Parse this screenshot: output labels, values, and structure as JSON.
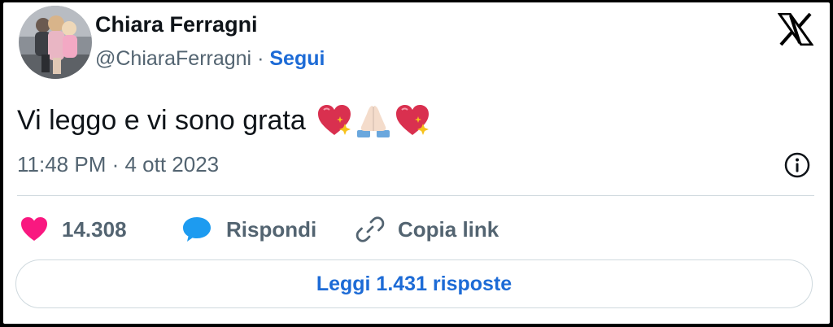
{
  "author": {
    "name": "Chiara Ferragni",
    "handle": "@ChiaraFerragni",
    "separator": "·",
    "follow_label": "Segui"
  },
  "tweet": {
    "text": "Vi leggo e vi sono grata",
    "emojis": [
      "sparkling-heart-icon",
      "folded-hands-icon",
      "sparkling-heart-icon"
    ],
    "time": "11:48 PM · 4 ott 2023"
  },
  "actions": {
    "likes": "14.308",
    "reply_label": "Rispondi",
    "copy_link_label": "Copia link"
  },
  "replies_button": "Leggi 1.431 risposte",
  "colors": {
    "accent": "#1d6bd6",
    "like": "#f91880",
    "reply": "#1d9bf0",
    "secondary_text": "#536471",
    "divider": "#cfd9de"
  }
}
